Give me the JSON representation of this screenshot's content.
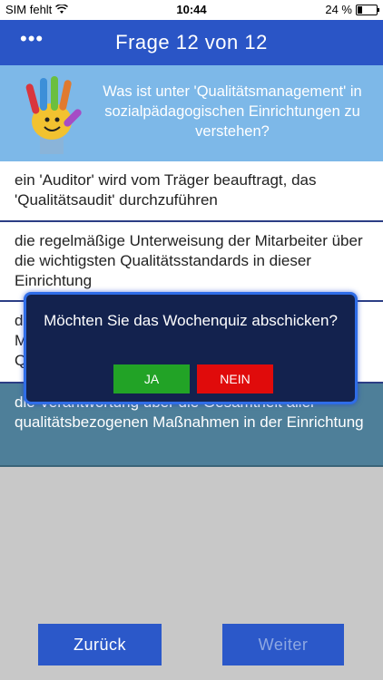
{
  "status": {
    "carrier": "SIM fehlt",
    "time": "10:44",
    "battery_text": "24 %",
    "battery_level": 0.24
  },
  "header": {
    "menu_icon": "more-icon",
    "title": "Frage 12 von 12"
  },
  "question": {
    "text": "Was ist unter 'Qualitätsmanagement' in sozialpädagogischen Einrichtungen zu verstehen?"
  },
  "answers": [
    "ein 'Auditor' wird vom Träger beauftragt, das 'Qualitätsaudit' durchzuführen",
    "die regelmäßige Unterweisung der Mitarbeiter über die wichtigsten Qualitätsstandards in dieser Einrichtung",
    "d\nM\nQ",
    "die Verantwortung über die Gesamtheit aller qualitätsbezogenen Maßnahmen in der Einrichtung"
  ],
  "dialog": {
    "message": "Möchten Sie das Wochenquiz abschicken?",
    "yes_label": "JA",
    "no_label": "NEIN"
  },
  "nav": {
    "back_label": "Zurück",
    "next_label": "Weiter"
  },
  "colors": {
    "header_bg": "#2a55c6",
    "question_bg": "#7db8e8",
    "selected_answer_bg": "#4e7f99",
    "dialog_bg": "#13224e",
    "yes_bg": "#22a326",
    "no_bg": "#e00b0b"
  }
}
